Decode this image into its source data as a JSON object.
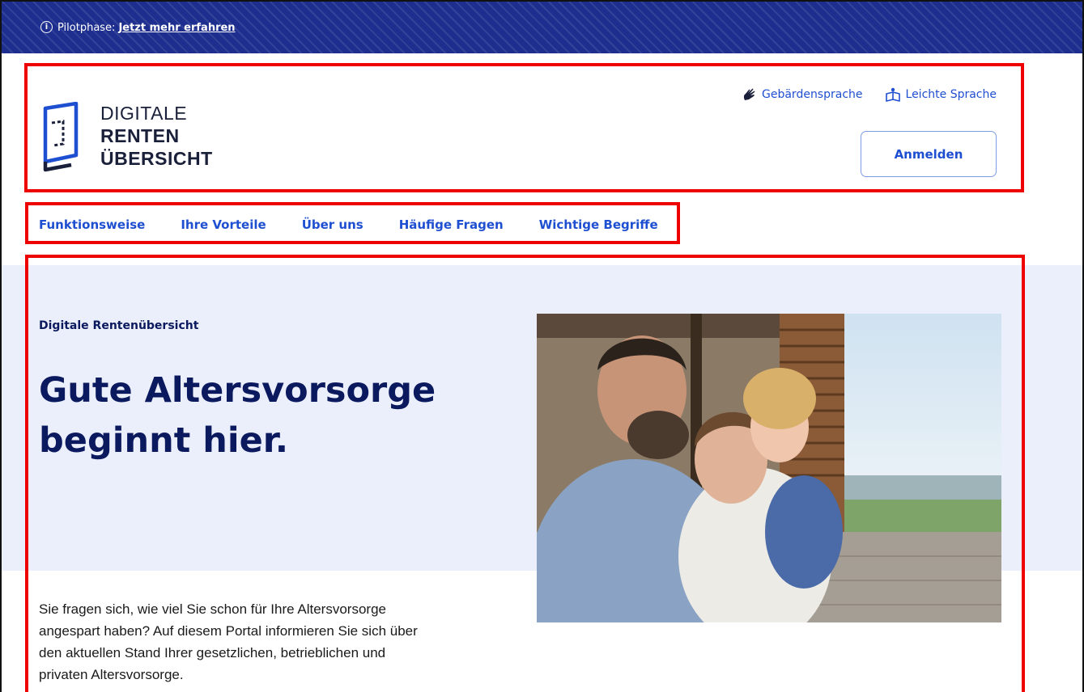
{
  "pilot_bar": {
    "prefix": "Pilotphase:",
    "link": "Jetzt mehr erfahren"
  },
  "logo": {
    "line1": "DIGITALE",
    "line2": "RENTEN",
    "line3": "ÜBERSICHT"
  },
  "accessibility": {
    "sign_language": "Gebärdensprache",
    "easy_language": "Leichte Sprache"
  },
  "login_label": "Anmelden",
  "nav": {
    "items": [
      {
        "label": "Funktionsweise"
      },
      {
        "label": "Ihre Vorteile"
      },
      {
        "label": "Über uns"
      },
      {
        "label": "Häufige Fragen"
      },
      {
        "label": "Wichtige Begriffe"
      }
    ]
  },
  "hero": {
    "eyebrow": "Digitale Rentenübersicht",
    "headline_line1": "Gute Altersvorsorge",
    "headline_line2": "beginnt hier.",
    "intro_line1": "Sie fragen sich, wie viel Sie schon für Ihre Altersvorsorge",
    "intro_line2": "angespart haben? Auf diesem Portal informieren Sie sich über",
    "intro_line3": "den aktuellen Stand Ihrer gesetzlichen, betrieblichen und",
    "intro_line4": "privaten Altersvorsorge."
  },
  "colors": {
    "brand_dark": "#0b1a5e",
    "link_blue": "#1f4fd1",
    "pilot_bar": "#1d2e8f",
    "hero_bg": "#ebeefb",
    "annotation_red": "#ee0000"
  },
  "icons": {
    "pilot_info": "info-icon",
    "sign_language": "hand-sign-icon",
    "easy_language": "easy-language-icon"
  }
}
